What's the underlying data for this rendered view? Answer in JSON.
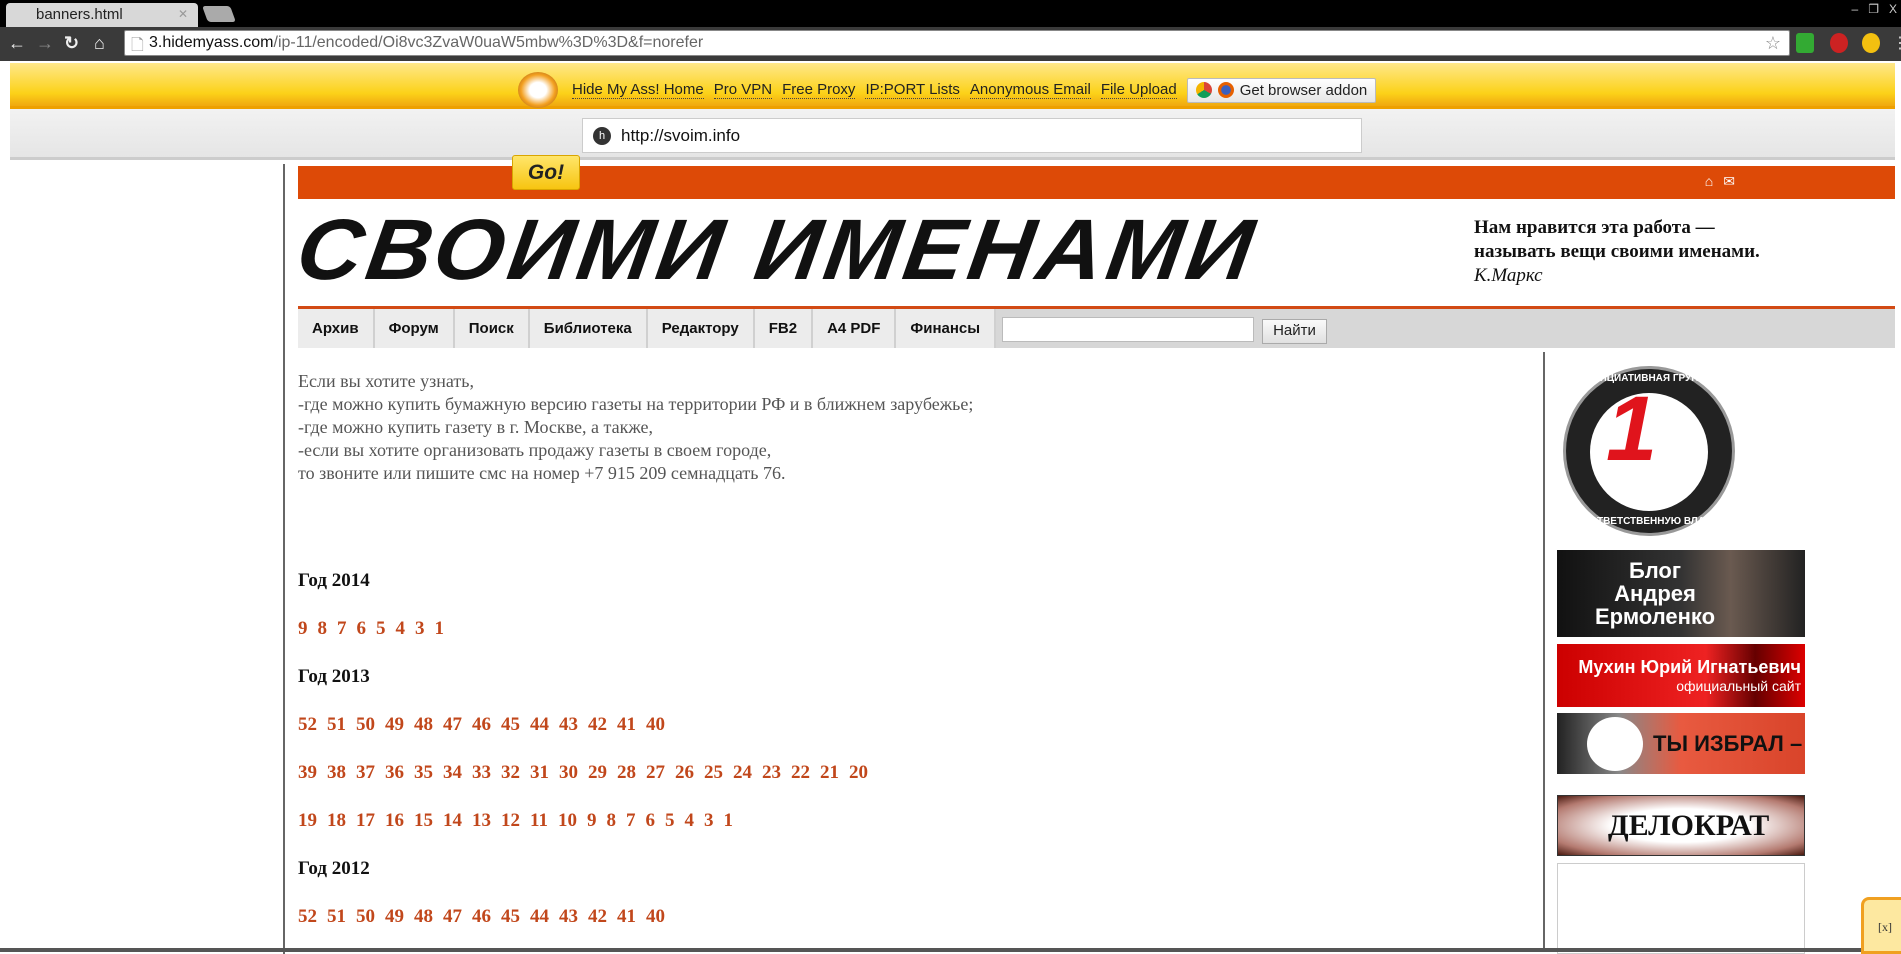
{
  "browser": {
    "tab_title": "banners.html",
    "url_host": "3.hidemyass.com",
    "url_path": "/ip-11/encoded/Oi8vc3ZvaW0uaW5mbw%3D%3D&f=norefer",
    "window_controls": [
      "–",
      "❐",
      "X"
    ]
  },
  "proxy": {
    "links": [
      "Hide My Ass! Home",
      "Pro VPN",
      "Free Proxy",
      "IP:PORT Lists",
      "Anonymous Email",
      "File Upload"
    ],
    "addon_label": "Get browser addon",
    "url_value": "http://svoim.info",
    "go_label": "Go!"
  },
  "site": {
    "logo_text": "СВОИМИ ИМЕНАМИ",
    "quote_line1": "Нам нравится эта работа —",
    "quote_line2": "называть вещи своими именами.",
    "quote_author": "К.Маркс",
    "nav": [
      "Архив",
      "Форум",
      "Поиск",
      "Библиотека",
      "Редактору",
      "FB2",
      "A4 PDF",
      "Финансы"
    ],
    "search_button": "Найти",
    "search_value": "",
    "intro": [
      "Если вы хотите узнать,",
      "-где можно купить бумажную версию газеты на территории РФ и в ближнем зарубежье;",
      "-где можно купить газету в г. Москве, а также,",
      "-если вы хотите организовать продажу газеты в своем городе,",
      "то звоните или пишите смс на номер +7 915 209 семнадцать 76."
    ],
    "years": [
      {
        "title": "Год 2014",
        "rows": [
          [
            "9",
            "8",
            "7",
            "6",
            "5",
            "4",
            "3",
            "1"
          ]
        ]
      },
      {
        "title": "Год 2013",
        "rows": [
          [
            "52",
            "51",
            "50",
            "49",
            "48",
            "47",
            "46",
            "45",
            "44",
            "43",
            "42",
            "41",
            "40"
          ],
          [
            "39",
            "38",
            "37",
            "36",
            "35",
            "34",
            "33",
            "32",
            "31",
            "30",
            "29",
            "28",
            "27",
            "26",
            "25",
            "24",
            "23",
            "22",
            "21",
            "20"
          ],
          [
            "19",
            "18",
            "17",
            "16",
            "15",
            "14",
            "13",
            "12",
            "11",
            "10",
            "9",
            "8",
            "7",
            "6",
            "5",
            "4",
            "3",
            "1"
          ]
        ]
      },
      {
        "title": "Год 2012",
        "rows": [
          [
            "52",
            "51",
            "50",
            "49",
            "48",
            "47",
            "46",
            "45",
            "44",
            "43",
            "42",
            "41",
            "40"
          ]
        ]
      }
    ]
  },
  "sidebar": {
    "circle_top": "ИНИЦИАТИВНАЯ ГРУППА",
    "circle_bottom": "ЗА ОТВЕТСТВЕННУЮ ВЛАСТЬ",
    "banner1": "Блог Андрея Ермоленко",
    "banner2_title": "Мухин Юрий Игнатьевич",
    "banner2_sub": "официальный сайт",
    "banner3": "ТЫ ИЗБРАЛ –",
    "banner4": "ДЕЛОКРАТ"
  },
  "widget": {
    "close_label": "[x]"
  },
  "colors": {
    "accent": "#dd4a07",
    "link": "#c1471b",
    "proxy_yellow": "#fcd219"
  }
}
